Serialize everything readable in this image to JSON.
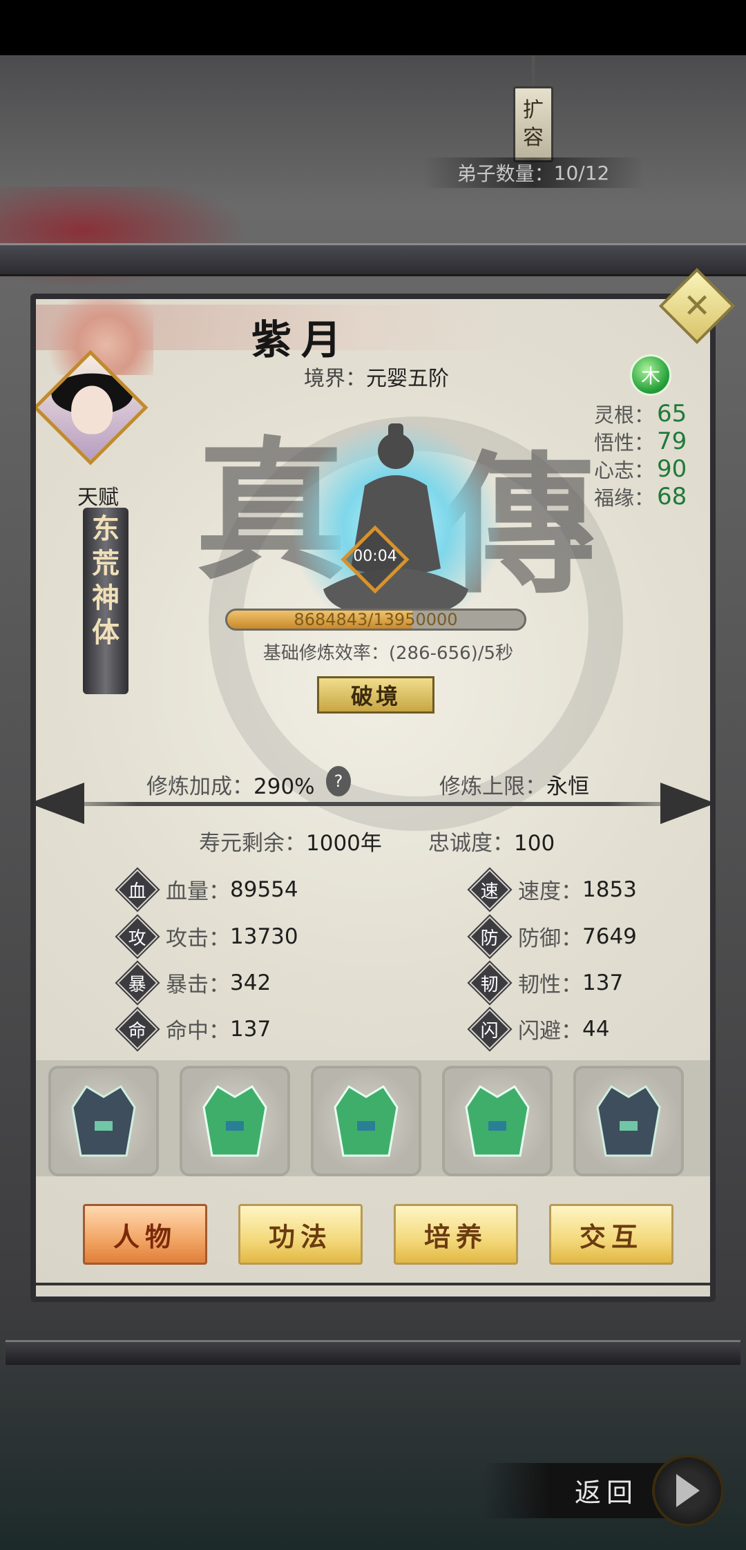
{
  "header": {
    "expand_label_line1": "扩",
    "expand_label_line2": "容",
    "disciple_count_label": "弟子数量：",
    "disciple_count_value": "10/12"
  },
  "character": {
    "name": "紫月",
    "realm_label": "境界：",
    "realm_value": "元婴五阶",
    "element": "木",
    "talent_label": "天赋",
    "talent_chars": [
      "东",
      "荒",
      "神",
      "体"
    ],
    "calligraphy_left": "真",
    "calligraphy_right": "傳",
    "meditation_timer": "00:04"
  },
  "aptitudes": [
    {
      "label": "灵根：",
      "value": "65"
    },
    {
      "label": "悟性：",
      "value": "79"
    },
    {
      "label": "心志：",
      "value": "90"
    },
    {
      "label": "福缘：",
      "value": "68"
    }
  ],
  "cultivation": {
    "progress_text": "8684843/13950000",
    "progress_fraction": 0.6226,
    "efficiency_text": "基础修炼效率：(286-656)/5秒",
    "breakthrough_label": "破境",
    "bonus_label": "修炼加成：",
    "bonus_value": "290%",
    "help_glyph": "?",
    "limit_label": "修炼上限：",
    "limit_value": "永恒",
    "lifespan_label": "寿元剩余：",
    "lifespan_value": "1000年",
    "loyalty_label": "忠诚度：",
    "loyalty_value": "100"
  },
  "attributes_left": [
    {
      "icon": "血",
      "label": "血量：",
      "value": "89554"
    },
    {
      "icon": "攻",
      "label": "攻击：",
      "value": "13730"
    },
    {
      "icon": "暴",
      "label": "暴击：",
      "value": "342"
    },
    {
      "icon": "命",
      "label": "命中：",
      "value": "137"
    }
  ],
  "attributes_right": [
    {
      "icon": "速",
      "label": "速度：",
      "value": "1853"
    },
    {
      "icon": "防",
      "label": "防御：",
      "value": "7649"
    },
    {
      "icon": "韧",
      "label": "韧性：",
      "value": "137"
    },
    {
      "icon": "闪",
      "label": "闪避：",
      "value": "44"
    }
  ],
  "equipment": [
    "robe-dark-icon",
    "robe-green-icon",
    "robe-green-icon",
    "robe-green-icon",
    "robe-dark-icon"
  ],
  "tabs": [
    {
      "label": "人物",
      "active": true
    },
    {
      "label": "功法",
      "active": false
    },
    {
      "label": "培养",
      "active": false
    },
    {
      "label": "交互",
      "active": false
    }
  ],
  "footer": {
    "return_label": "返回"
  },
  "colors": {
    "accent_gold": "#e3b844",
    "active_tab": "#f2a565",
    "aptitude_value": "#1f7a3a",
    "progress_fill": "#c9892a"
  }
}
